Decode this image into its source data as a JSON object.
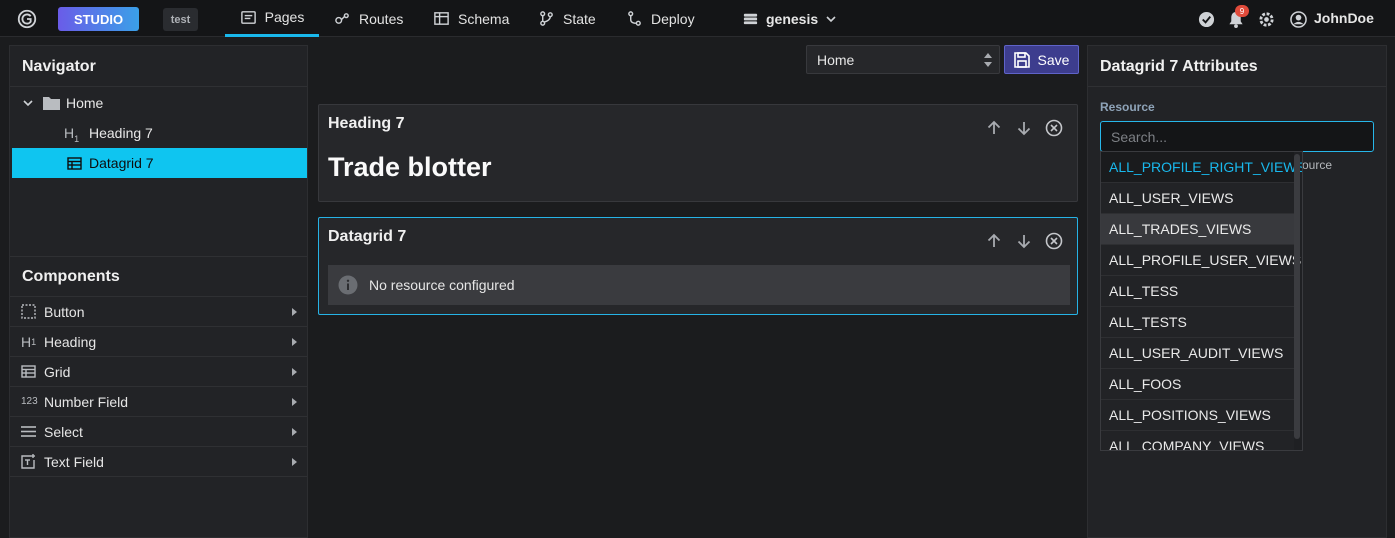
{
  "header": {
    "studio_label": "STUDIO",
    "env_badge": "test",
    "tabs": [
      {
        "label": "Pages",
        "icon": "pages-icon"
      },
      {
        "label": "Routes",
        "icon": "routes-icon"
      },
      {
        "label": "Schema",
        "icon": "schema-icon"
      },
      {
        "label": "State",
        "icon": "state-icon"
      },
      {
        "label": "Deploy",
        "icon": "deploy-icon"
      }
    ],
    "project": "genesis",
    "notification_count": "9",
    "username": "JohnDoe"
  },
  "navigator": {
    "title": "Navigator",
    "tree": [
      {
        "label": "Home",
        "icon": "folder-icon"
      },
      {
        "label": "Heading 7",
        "icon": "heading-icon"
      },
      {
        "label": "Datagrid 7",
        "icon": "grid-icon"
      }
    ]
  },
  "components": {
    "title": "Components",
    "items": [
      {
        "label": "Button",
        "icon": "button-icon"
      },
      {
        "label": "Heading",
        "icon": "heading-icon"
      },
      {
        "label": "Grid",
        "icon": "grid-icon"
      },
      {
        "label": "Number Field",
        "icon": "number-icon",
        "icon_text": "123"
      },
      {
        "label": "Select",
        "icon": "select-icon"
      },
      {
        "label": "Text Field",
        "icon": "text-field-icon"
      }
    ]
  },
  "toolbar": {
    "page_value": "Home",
    "save_label": "Save"
  },
  "canvas": {
    "heading_card": {
      "title": "Heading 7",
      "content": "Trade blotter"
    },
    "grid_card": {
      "title": "Datagrid 7",
      "message": "No resource configured"
    }
  },
  "attributes": {
    "title": "Datagrid 7 Attributes",
    "resource_label": "Resource",
    "search_placeholder": "Search...",
    "hint_fragment": "ource",
    "options": [
      "ALL_PROFILE_RIGHT_VIEWS",
      "ALL_USER_VIEWS",
      "ALL_TRADES_VIEWS",
      "ALL_PROFILE_USER_VIEWS",
      "ALL_TESS",
      "ALL_TESTS",
      "ALL_USER_AUDIT_VIEWS",
      "ALL_FOOS",
      "ALL_POSITIONS_VIEWS",
      "ALL_COMPANY_VIEWS"
    ],
    "active_option_index": 0,
    "hover_option_index": 2
  },
  "colors": {
    "accent": "#19b8ec",
    "selected_row": "#0fc5f0",
    "save_button": "#3d3d8e",
    "notification": "#e14b3b"
  }
}
